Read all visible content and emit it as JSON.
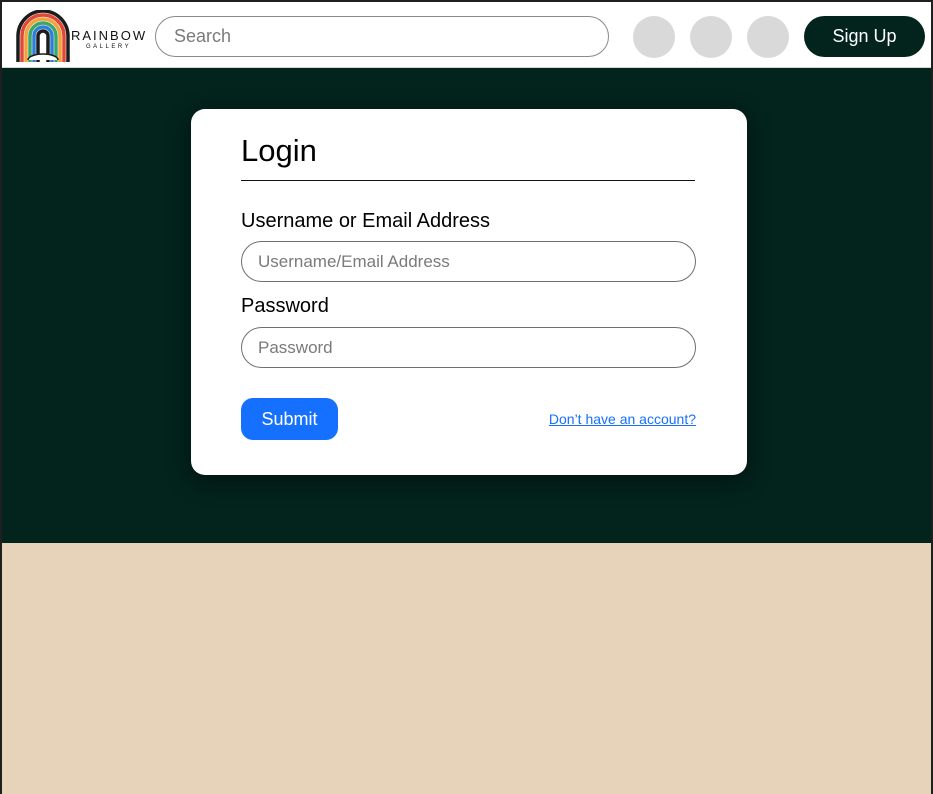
{
  "brand": {
    "name": "RAINBOW",
    "sub": "GALLERY"
  },
  "header": {
    "search_placeholder": "Search",
    "signup_label": "Sign Up"
  },
  "login": {
    "title": "Login",
    "username_label": "Username or Email Address",
    "username_placeholder": "Username/Email Address",
    "password_label": "Password",
    "password_placeholder": "Password",
    "submit_label": "Submit",
    "signup_link": "Don’t have an account?"
  },
  "colors": {
    "header_bg": "#ffffff",
    "hero_bg": "#03231d",
    "footer_bg": "#e6d3b9",
    "accent": "#1670ff",
    "signup_bg": "#03231d",
    "circle_gray": "#d9d9d9"
  }
}
